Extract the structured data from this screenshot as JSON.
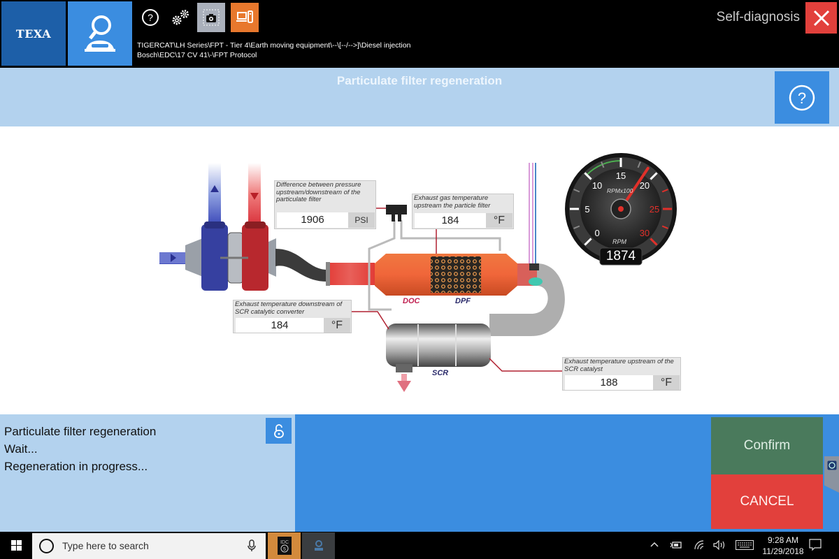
{
  "topbar": {
    "logo": "TEXA",
    "breadcrumb_line1": "TIGERCAT\\LH Series\\FPT - Tier 4\\Earth moving equipment\\--\\[--/-->]\\Diesel injection",
    "breadcrumb_line2": "Bosch\\EDC\\17 CV 41\\-\\FPT Protocol",
    "app_title": "Self-diagnosis",
    "icons": [
      "vehicle-diagnosis-icon",
      "help-icon",
      "settings-gears-icon",
      "screenshot-camera-icon",
      "device-mode-icon",
      "close-icon"
    ]
  },
  "header": {
    "title": "Particulate filter regeneration"
  },
  "diagram": {
    "sensors": [
      {
        "label": "Difference between pressure upstream/downstream  of the particulate  filter",
        "value": "1906",
        "unit": "PSI"
      },
      {
        "label": "Exhaust gas temperature upstream  the particle filter",
        "value": "184",
        "unit": "°F"
      },
      {
        "label": "Exhaust temperature downstream of SCR  catalytic converter",
        "value": "184",
        "unit": "°F"
      },
      {
        "label": "Exhaust temperature upstream of the  SCR catalyst",
        "value": "188",
        "unit": "°F"
      }
    ],
    "tags": {
      "doc": "DOC",
      "dpf": "DPF",
      "scr": "SCR"
    },
    "gauge": {
      "scale_label": "RPMx100",
      "unit_label": "RPM",
      "ticks": [
        "0",
        "5",
        "10",
        "15",
        "20",
        "25",
        "30"
      ],
      "min": 0,
      "max": 30,
      "value": 1874,
      "value_display": "1874"
    }
  },
  "status": {
    "lines": [
      "Particulate filter regeneration",
      "Wait...",
      "Regeneration in progress..."
    ]
  },
  "actions": {
    "confirm": "Confirm",
    "cancel": "CANCEL"
  },
  "taskbar": {
    "search_placeholder": "Type here to search",
    "time": "9:28 AM",
    "date": "11/29/2018"
  }
}
